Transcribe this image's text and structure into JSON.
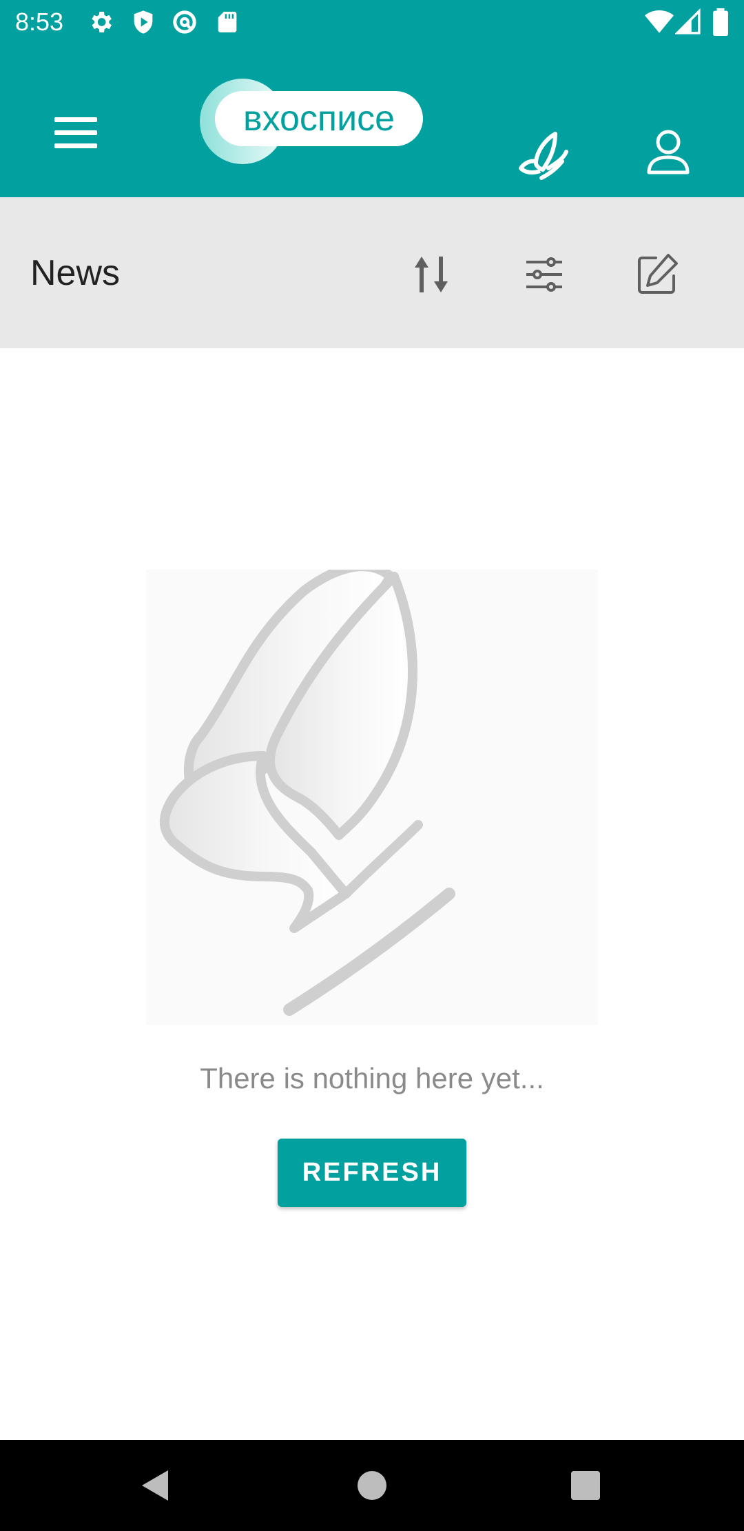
{
  "status_bar": {
    "time": "8:53",
    "left_icons": [
      "gear-icon",
      "shield-play-icon",
      "at-sign-icon",
      "sd-card-icon"
    ],
    "right_icons": [
      "wifi-icon",
      "signal-icon",
      "battery-icon"
    ]
  },
  "app_bar": {
    "logo_text": "вхосписе",
    "icons": [
      "menu-icon",
      "butterfly-icon",
      "profile-icon"
    ],
    "accent_color": "#02a19f"
  },
  "sub_bar": {
    "title": "News",
    "icons": [
      "sort-icon",
      "filter-icon",
      "edit-icon"
    ]
  },
  "empty_state": {
    "message": "There is nothing here yet...",
    "button_label": "REFRESH"
  },
  "nav_bar": {
    "icons": [
      "back-icon",
      "home-icon",
      "recents-icon"
    ]
  }
}
